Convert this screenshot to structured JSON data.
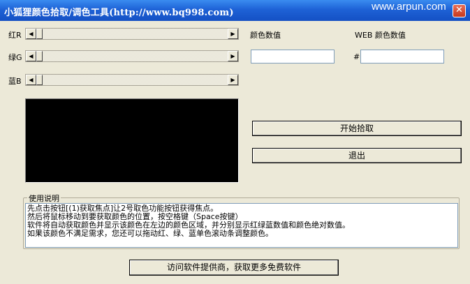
{
  "window": {
    "title": "小狐狸颜色拾取/调色工具(http://www.bq998.com)",
    "watermark": "www.arpun.com",
    "close_label": "✕"
  },
  "channels": [
    {
      "label": "红R",
      "value": 0
    },
    {
      "label": "绿G",
      "value": 0
    },
    {
      "label": "蓝B",
      "value": 0
    }
  ],
  "color_value": {
    "label": "颜色数值",
    "value": ""
  },
  "web_value": {
    "label": "WEB 颜色数值",
    "prefix": "#",
    "value": ""
  },
  "buttons": {
    "start": "开始拾取",
    "exit": "退出",
    "visit": "访问软件提供商，获取更多免费软件"
  },
  "instructions": {
    "title": "使用说明",
    "lines": [
      "先点击按钮[(1)获取焦点]让2号取色功能按钮获得焦点。",
      "然后将鼠标移动到要获取颜色的位置，按空格键（Space按键）",
      "软件将自动获取颜色并显示该颜色在左边的颜色区域，并分别显示红绿蓝数值和颜色绝对数值。",
      "如果该颜色不满足需求，您还可以拖动红、绿、蓝单色滚动条调整颜色。"
    ]
  }
}
